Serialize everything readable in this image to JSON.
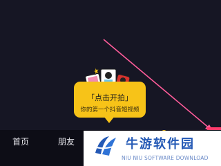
{
  "tooltip": {
    "title": "「点击开拍」",
    "subtitle": "你的第一个抖音短视频"
  },
  "nav": {
    "home_label": "首页",
    "friends_label": "朋友"
  },
  "watermark": {
    "name": "牛游软件园",
    "english": "NIU NIU SOFTWARE DOWNLOAD"
  },
  "colors": {
    "background": "#161624",
    "tooltip": "#f7c318",
    "arrow": "#ff5c9a",
    "watermark_blue": "#2459b5"
  }
}
